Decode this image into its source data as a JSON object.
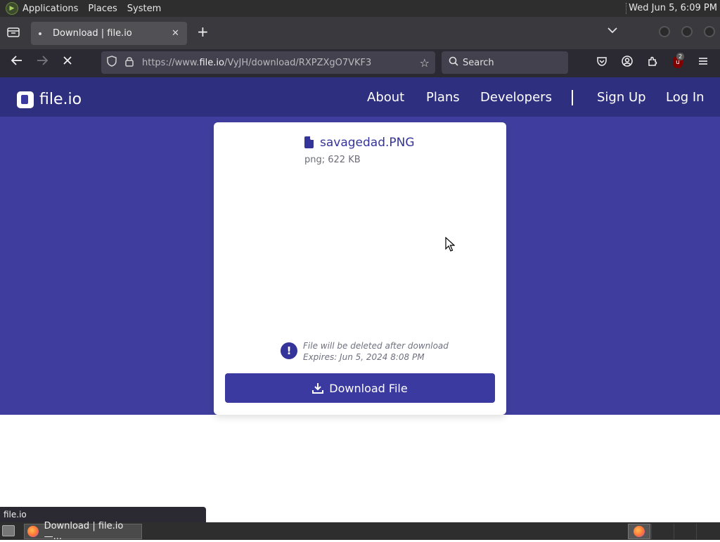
{
  "top_panel": {
    "menus": [
      "Applications",
      "Places",
      "System"
    ],
    "clock": "Wed Jun  5,  6:09 PM"
  },
  "browser": {
    "tab_title": "Download | file.io",
    "new_tab_label": "+",
    "url_prefix": "https://www.",
    "url_host": "file.io",
    "url_path": "/VyJH/download/RXPZXgO7VKF3",
    "search_placeholder": "Search",
    "ublock_count": "2",
    "status_text": "file.io"
  },
  "site": {
    "logo_text": "file.io",
    "nav": {
      "about": "About",
      "plans": "Plans",
      "developers": "Developers",
      "sign_up": "Sign Up",
      "log_in": "Log In"
    }
  },
  "file": {
    "name": "savagedad.PNG",
    "meta": "png; 622 KB",
    "warning_line1": "File will be deleted after download",
    "warning_line2": "Expires: Jun 5, 2024 8:08 PM",
    "download_label": "Download File"
  },
  "taskbar": {
    "task_label": "Download | file.io —..."
  },
  "colors": {
    "header_bg": "#2f2f80",
    "hero_bg": "#3f3e9e",
    "accent": "#3b3aa0"
  }
}
